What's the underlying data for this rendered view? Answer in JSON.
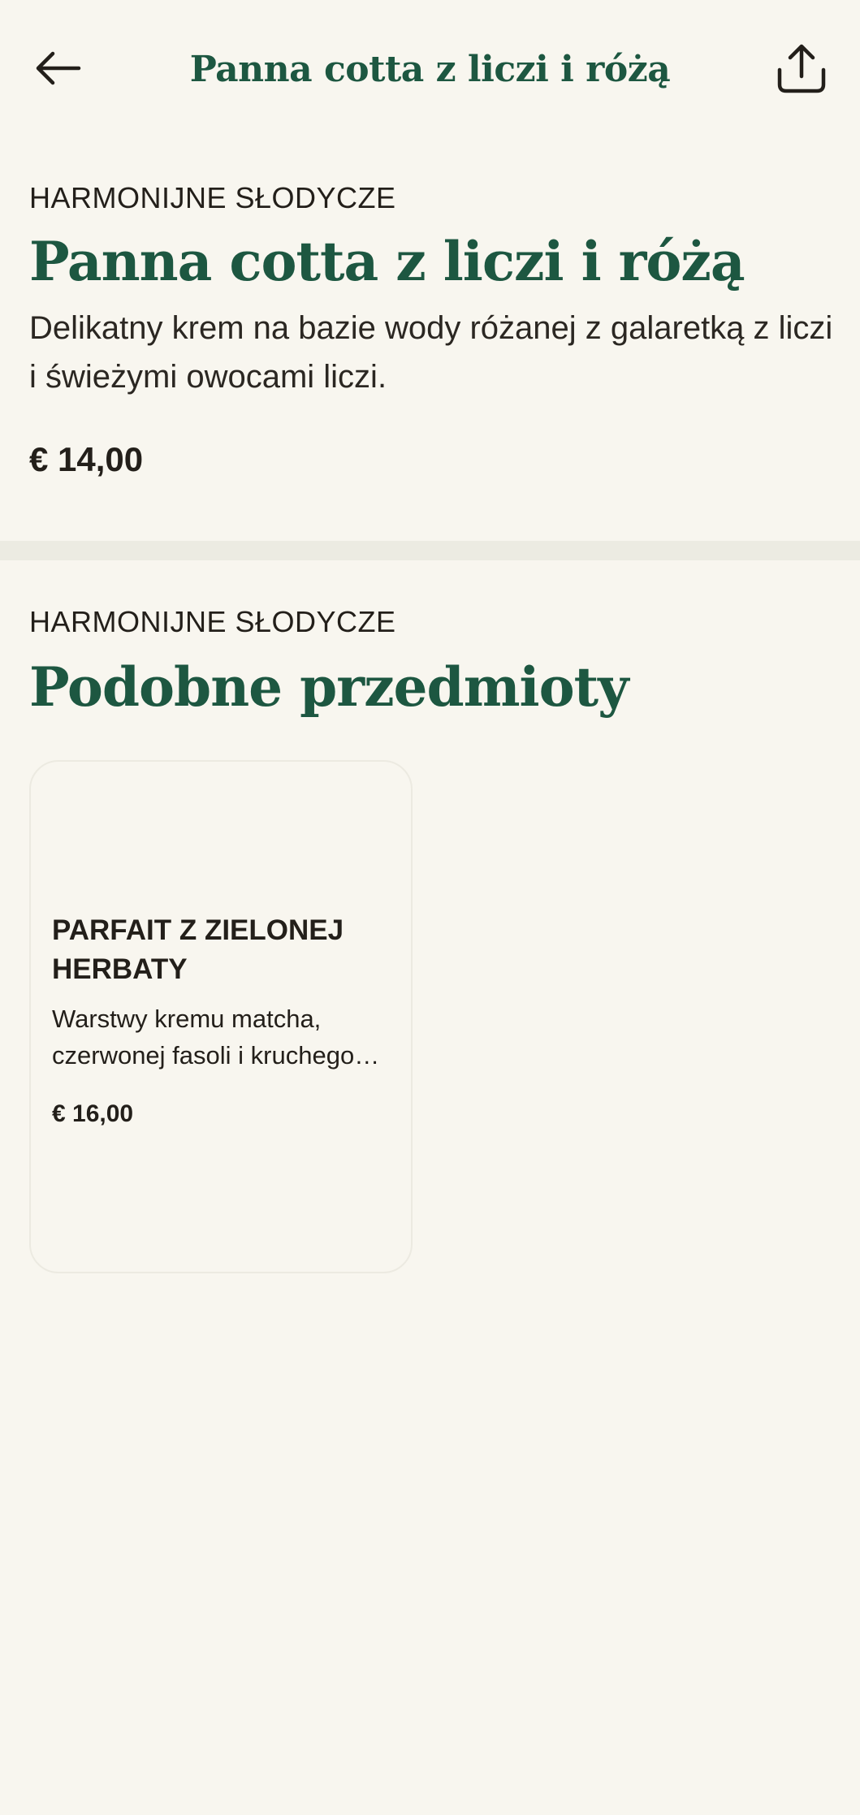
{
  "header": {
    "title": "Panna cotta z liczi i różą",
    "back_icon": "arrow-left-icon",
    "share_icon": "share-upload-icon"
  },
  "product": {
    "category": "HARMONIJNE SŁODYCZE",
    "title": "Panna cotta z liczi i różą",
    "description": "Delikatny krem na bazie wody różanej z galaretką z liczi i świeżymi owocami liczi.",
    "price": "€ 14,00"
  },
  "similar": {
    "category": "HARMONIJNE SŁODYCZE",
    "title": "Podobne przedmioty",
    "items": [
      {
        "name": "PARFAIT Z ZIELONEJ HERBATY",
        "description": "Warstwy kremu matcha, czerwonej fasoli i kruchego ciasta",
        "price": "€ 16,00"
      }
    ]
  },
  "colors": {
    "background": "#f8f6ef",
    "accent_green": "#1d5741",
    "text": "#231f1a",
    "divider": "#ecebe2"
  }
}
